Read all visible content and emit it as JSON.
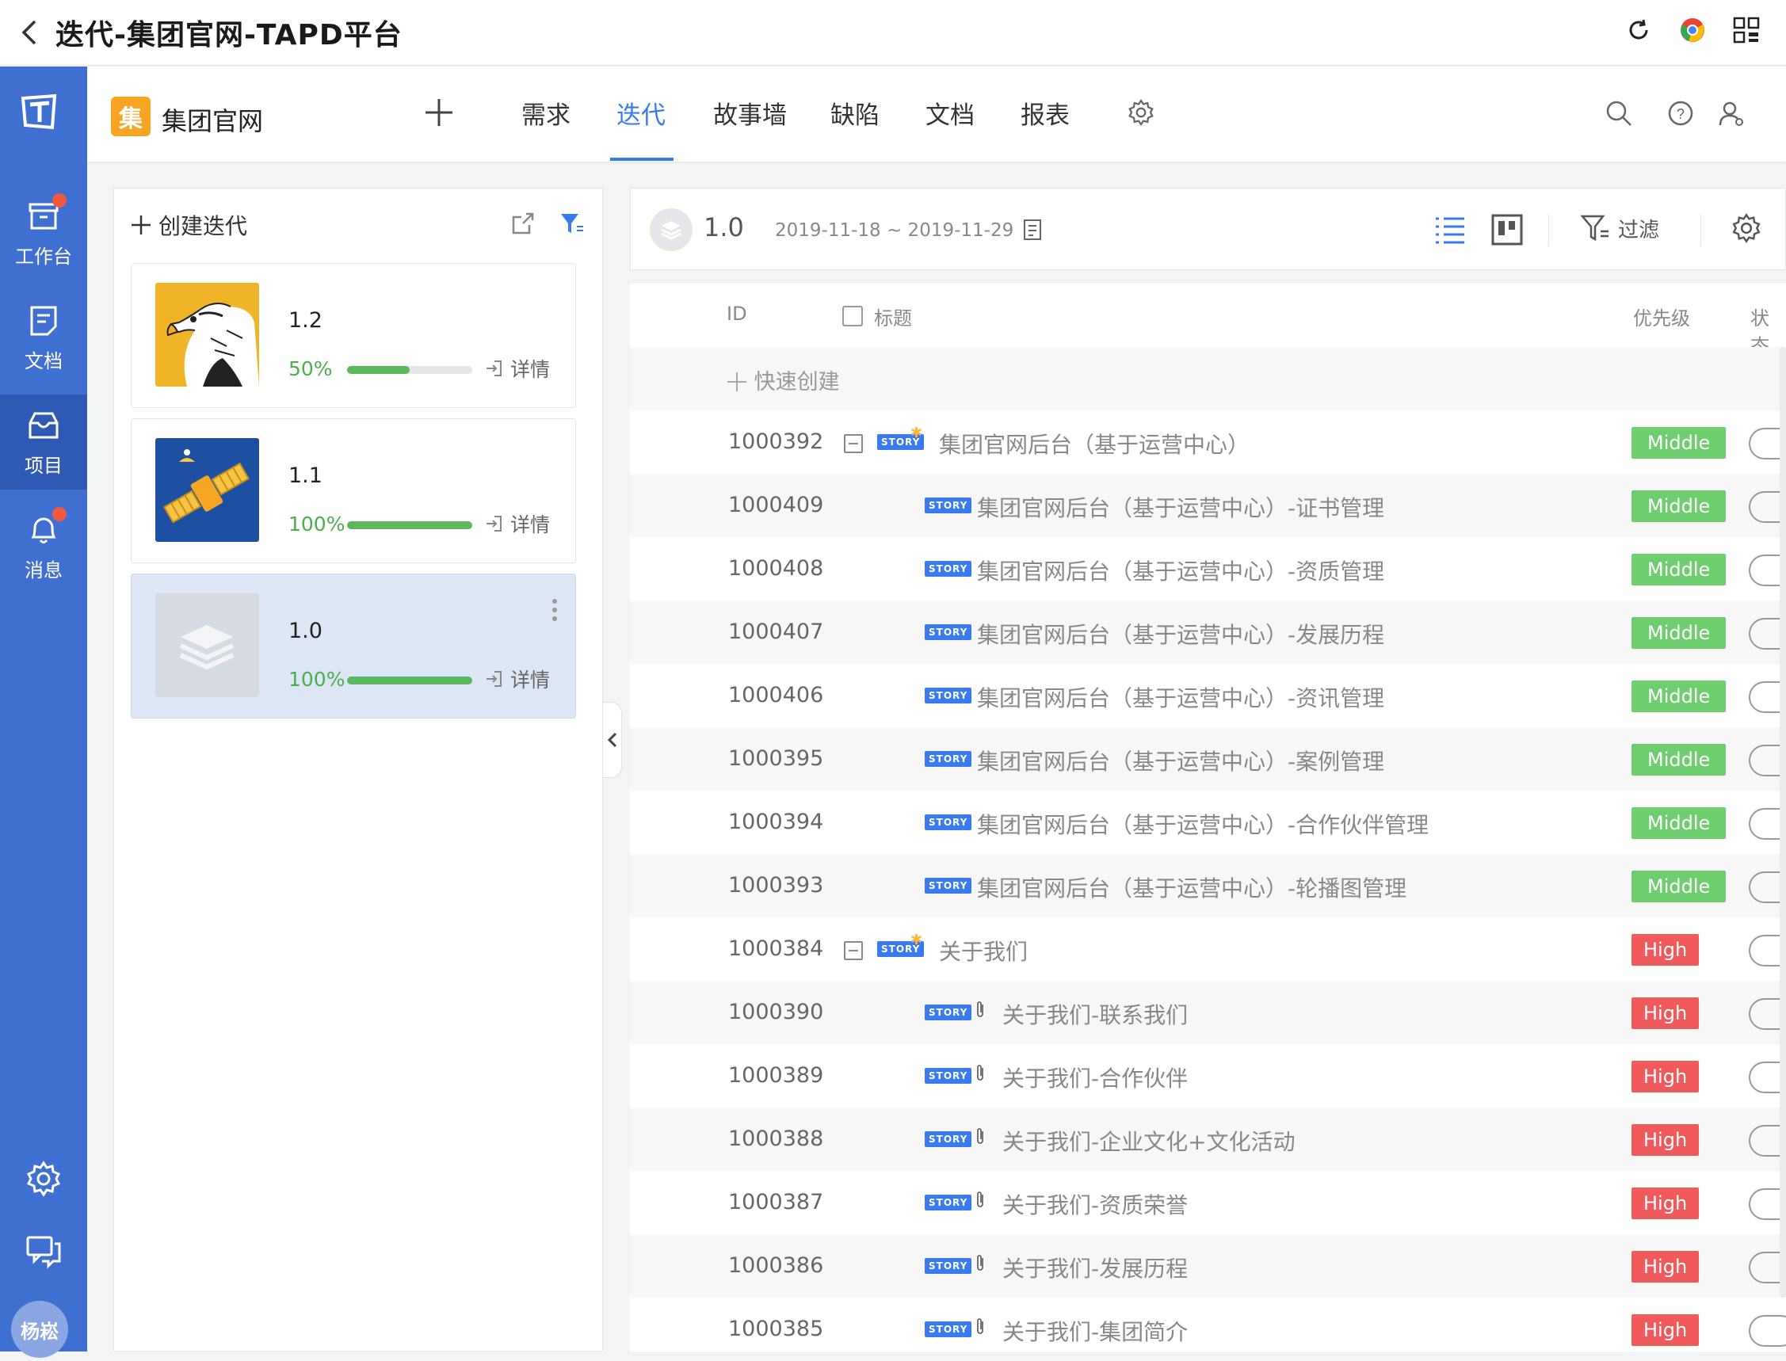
{
  "window": {
    "title": "迭代-集团官网-TAPD平台"
  },
  "leftnav": {
    "items": [
      {
        "label": "工作台",
        "icon": "inbox-icon",
        "badge": true
      },
      {
        "label": "文档",
        "icon": "document-icon",
        "badge": false
      },
      {
        "label": "项目",
        "icon": "project-icon",
        "badge": false,
        "active": true
      },
      {
        "label": "消息",
        "icon": "bell-icon",
        "badge": true
      }
    ],
    "avatar_text": "杨崧"
  },
  "project": {
    "badge": "集",
    "name": "集团官网",
    "tabs": [
      {
        "label": "需求",
        "active": false
      },
      {
        "label": "迭代",
        "active": true
      },
      {
        "label": "故事墙",
        "active": false
      },
      {
        "label": "缺陷",
        "active": false
      },
      {
        "label": "文档",
        "active": false
      },
      {
        "label": "报表",
        "active": false
      }
    ]
  },
  "iterations": {
    "create_label": "创建迭代",
    "detail_label": "详情",
    "items": [
      {
        "version": "1.2",
        "progress": 50,
        "progress_label": "50%",
        "thumb": "eagle"
      },
      {
        "version": "1.1",
        "progress": 100,
        "progress_label": "100%",
        "thumb": "satellite"
      },
      {
        "version": "1.0",
        "progress": 100,
        "progress_label": "100%",
        "thumb": "layers",
        "active": true
      }
    ]
  },
  "current": {
    "version": "1.0",
    "date_range": "2019-11-18 ~ 2019-11-29",
    "filter_label": "过滤"
  },
  "table": {
    "headers": {
      "id": "ID",
      "title": "标题",
      "priority": "优先级",
      "status": "状态"
    },
    "quick_create": "快速创建",
    "story_tag": "STORY",
    "rows": [
      {
        "id": "1000392",
        "title": "集团官网后台（基于运营中心）",
        "priority": "Middle",
        "parent": true
      },
      {
        "id": "1000409",
        "title": "集团官网后台（基于运营中心）-证书管理",
        "priority": "Middle"
      },
      {
        "id": "1000408",
        "title": "集团官网后台（基于运营中心）-资质管理",
        "priority": "Middle"
      },
      {
        "id": "1000407",
        "title": "集团官网后台（基于运营中心）-发展历程",
        "priority": "Middle"
      },
      {
        "id": "1000406",
        "title": "集团官网后台（基于运营中心）-资讯管理",
        "priority": "Middle"
      },
      {
        "id": "1000395",
        "title": "集团官网后台（基于运营中心）-案例管理",
        "priority": "Middle"
      },
      {
        "id": "1000394",
        "title": "集团官网后台（基于运营中心）-合作伙伴管理",
        "priority": "Middle"
      },
      {
        "id": "1000393",
        "title": "集团官网后台（基于运营中心）-轮播图管理",
        "priority": "Middle"
      },
      {
        "id": "1000384",
        "title": "关于我们",
        "priority": "High",
        "parent": true
      },
      {
        "id": "1000390",
        "title": "关于我们-联系我们",
        "priority": "High",
        "attach": true
      },
      {
        "id": "1000389",
        "title": "关于我们-合作伙伴",
        "priority": "High",
        "attach": true
      },
      {
        "id": "1000388",
        "title": "关于我们-企业文化+文化活动",
        "priority": "High",
        "attach": true
      },
      {
        "id": "1000387",
        "title": "关于我们-资质荣誉",
        "priority": "High",
        "attach": true
      },
      {
        "id": "1000386",
        "title": "关于我们-发展历程",
        "priority": "High",
        "attach": true
      },
      {
        "id": "1000385",
        "title": "关于我们-集团简介",
        "priority": "High",
        "attach": true
      }
    ]
  },
  "colors": {
    "accent": "#3a7af0",
    "nav": "#3f6fd0",
    "middle": "#6fcf6f",
    "high": "#f05a5a"
  }
}
